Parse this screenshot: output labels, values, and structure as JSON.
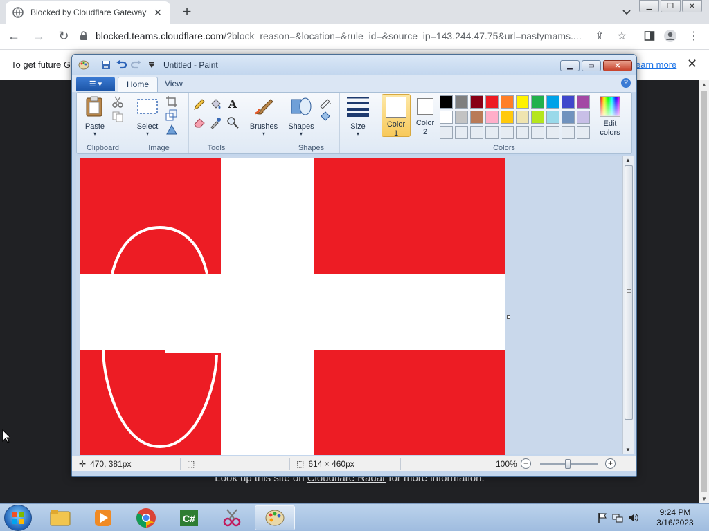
{
  "browser": {
    "tab_title": "Blocked by Cloudflare Gateway",
    "tab_close": "✕",
    "new_tab": "+",
    "url_host": "blocked.teams.cloudflare.com",
    "url_rest": "/?block_reason=&location=&rule_id=&source_ip=143.244.47.75&url=nastymams....",
    "infobar_text": "To get future G",
    "infobar_link": "earn more",
    "infobar_close": "✕"
  },
  "page": {
    "footer_prefix": "Look up this site on ",
    "footer_link": "Cloudflare Radar",
    "footer_suffix": " for more information."
  },
  "paint": {
    "title": "Untitled - Paint",
    "tabs": [
      "Home",
      "View"
    ],
    "groups": {
      "clipboard": "Clipboard",
      "image": "Image",
      "tools": "Tools",
      "shapes": "Shapes",
      "colors": "Colors"
    },
    "buttons": {
      "paste": "Paste",
      "select": "Select",
      "brushes": "Brushes",
      "shapes": "Shapes",
      "size": "Size",
      "color1_line1": "Color",
      "color1_line2": "1",
      "color2_line1": "Color",
      "color2_line2": "2",
      "edit_colors_line1": "Edit",
      "edit_colors_line2": "colors"
    },
    "palette_row1": [
      "#000000",
      "#7f7f7f",
      "#880015",
      "#ed1c24",
      "#ff7f27",
      "#fff200",
      "#22b14c",
      "#00a2e8",
      "#3f48cc",
      "#a349a4"
    ],
    "palette_row2": [
      "#ffffff",
      "#c3c3c3",
      "#b97a57",
      "#ffaec9",
      "#ffc90e",
      "#efe4b0",
      "#b5e61d",
      "#99d9ea",
      "#7092be",
      "#c8bfe7"
    ],
    "status": {
      "cursor_pos": "470, 381px",
      "image_size": "614 × 460px",
      "zoom": "100%"
    },
    "flag_colors": {
      "red": "#ed1c24",
      "white": "#ffffff"
    }
  },
  "taskbar": {
    "time": "9:24 PM",
    "date": "3/16/2023"
  }
}
